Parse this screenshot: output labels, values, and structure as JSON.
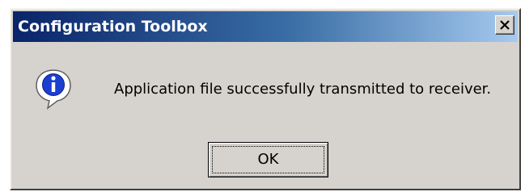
{
  "window": {
    "title": "Configuration Toolbox",
    "close_icon": "close-icon",
    "titlebar_color_start": "#0a246a",
    "titlebar_color_end": "#a6caf0"
  },
  "dialog": {
    "icon": "info-icon",
    "message": "Application file successfully transmitted to receiver.",
    "ok_label": "OK"
  }
}
